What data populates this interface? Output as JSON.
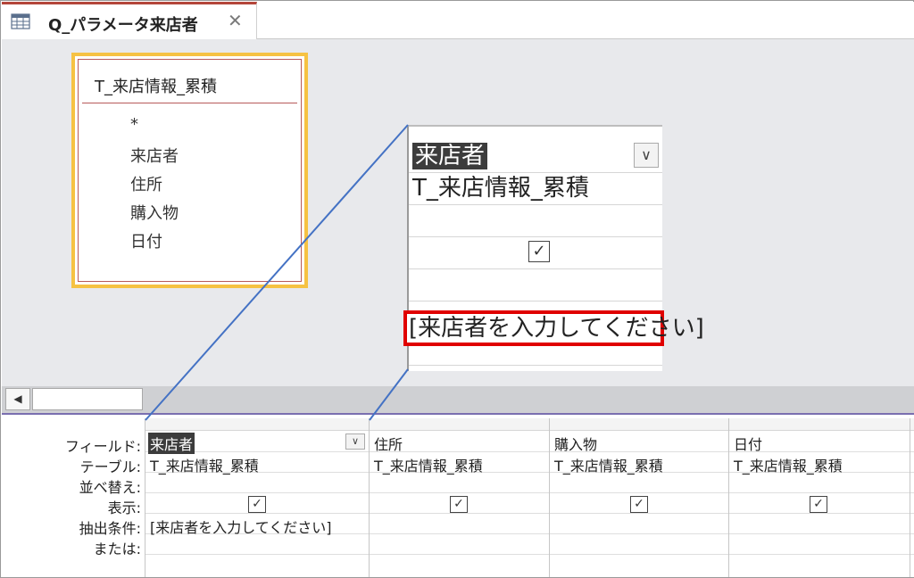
{
  "tab": {
    "title": "Q_パラメータ来店者",
    "close_glyph": "✕",
    "icon": "query-icon"
  },
  "table_box": {
    "title": "T_来店情報_累積",
    "fields": [
      "*",
      "来店者",
      "住所",
      "購入物",
      "日付"
    ]
  },
  "zoom": {
    "field": "来店者",
    "dropdown_glyph": "∨",
    "table": "T_来店情報_累積",
    "check_glyph": "✓",
    "criteria": "[来店者を入力してください]"
  },
  "scroll": {
    "left_glyph": "◀"
  },
  "grid": {
    "row_labels": [
      "フィールド:",
      "テーブル:",
      "並べ替え:",
      "表示:",
      "抽出条件:",
      "または:"
    ],
    "dropdown_glyph": "∨",
    "check_glyph": "✓",
    "columns": [
      {
        "field": "来店者",
        "table": "T_来店情報_累積",
        "criteria": "[来店者を入力してください]"
      },
      {
        "field": "住所",
        "table": "T_来店情報_累積",
        "criteria": ""
      },
      {
        "field": "購入物",
        "table": "T_来店情報_累積",
        "criteria": ""
      },
      {
        "field": "日付",
        "table": "T_来店情報_累積",
        "criteria": ""
      }
    ]
  },
  "colors": {
    "tab_accent": "#b4453a",
    "table_highlight": "#f6c243",
    "criteria_highlight": "#e00000",
    "callout_line": "#4472c4"
  }
}
